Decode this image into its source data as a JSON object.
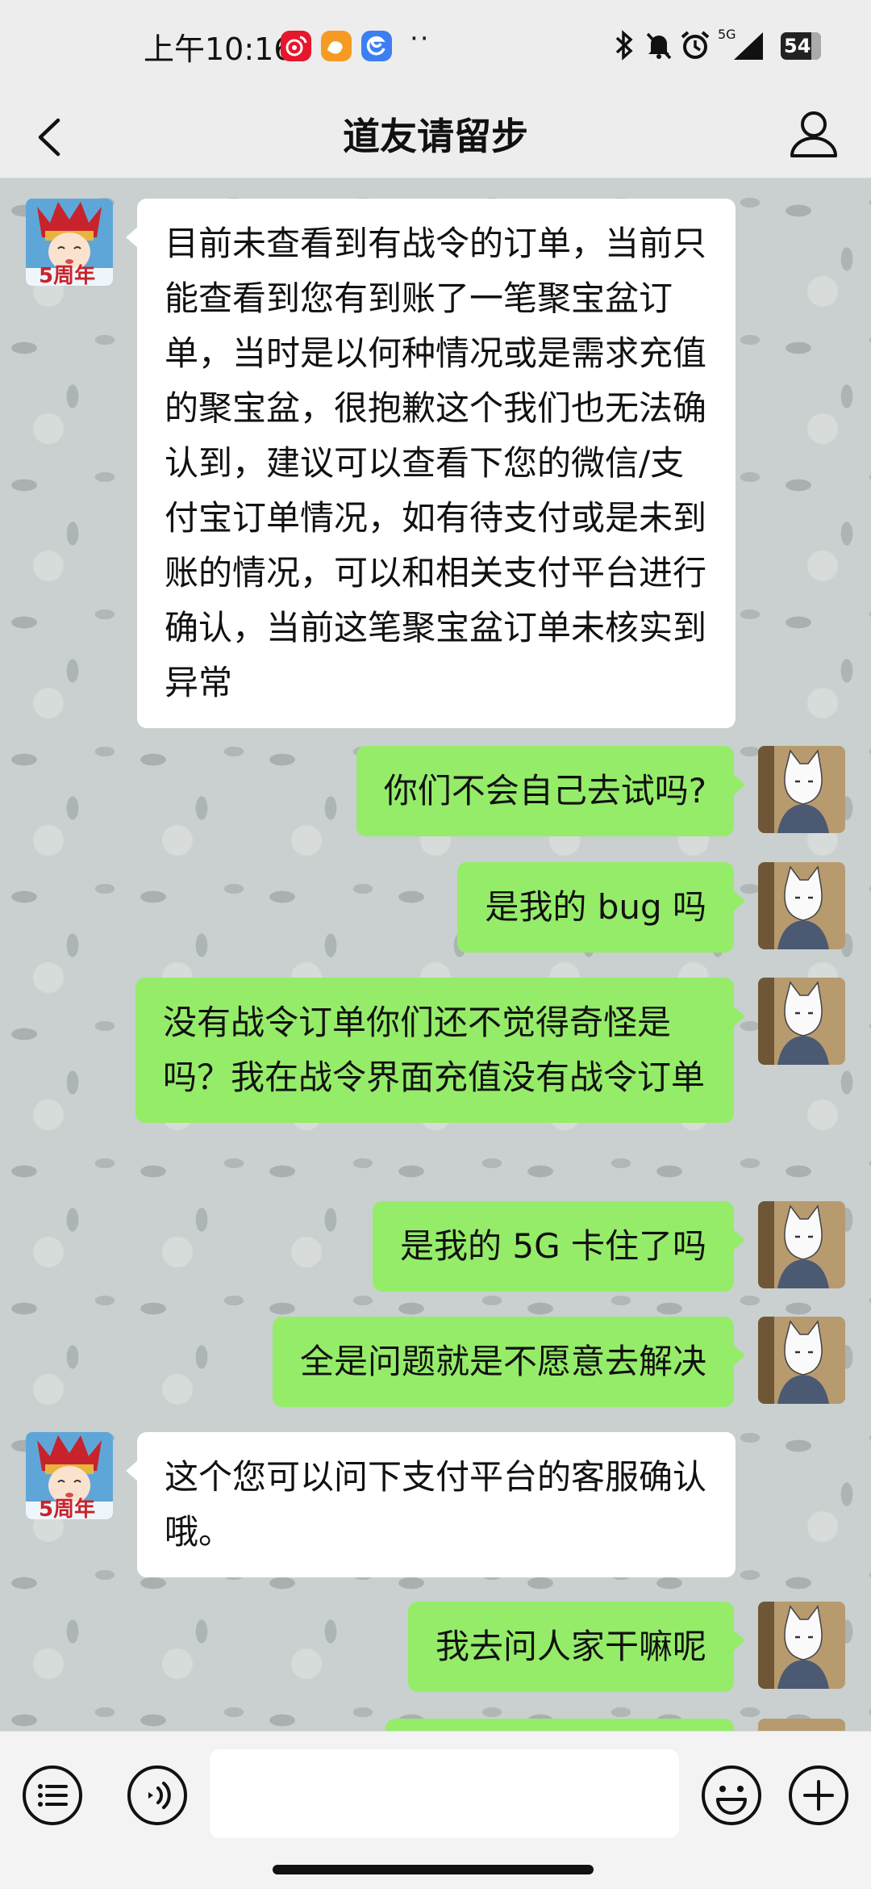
{
  "status_bar": {
    "time": "上午10:16",
    "notification_icons": [
      "weibo-icon",
      "uc-browser-icon",
      "edge-browser-icon"
    ],
    "more": "··",
    "right_icons": [
      "bluetooth-icon",
      "mute-icon",
      "alarm-icon",
      "signal-5g-icon"
    ],
    "network": "5G",
    "battery": "54"
  },
  "header": {
    "title": "道友请留步"
  },
  "messages": [
    {
      "side": "left",
      "text": "目前未查看到有战令的订单，当前只能查看到您有到账了一笔聚宝盆订单，当时是以何种情况或是需求充值的聚宝盆，很抱歉这个我们也无法确认到，建议可以查看下您的微信/支付宝订单情况，如有待支付或是未到账的情况，可以和相关支付平台进行确认，当前这笔聚宝盆订单未核实到异常",
      "avatar_badge": "5周年"
    },
    {
      "side": "right",
      "text": "你们不会自己去试吗?"
    },
    {
      "side": "right",
      "text": "是我的 bug 吗"
    },
    {
      "side": "right",
      "text": "没有战令订单你们还不觉得奇怪是吗？我在战令界面充值没有战令订单"
    },
    {
      "side": "right",
      "text": "是我的 5G 卡住了吗"
    },
    {
      "side": "right",
      "text": "全是问题就是不愿意去解决"
    },
    {
      "side": "left",
      "text": "这个您可以问下支付平台的客服确认哦。",
      "avatar_badge": "5周年"
    },
    {
      "side": "right",
      "text": "我去问人家干嘛呢"
    }
  ],
  "input_bar": {
    "message_value": ""
  },
  "colors": {
    "sent_bubble": "#95ec69",
    "received_bubble": "#ffffff",
    "header_bg": "#ededed"
  }
}
